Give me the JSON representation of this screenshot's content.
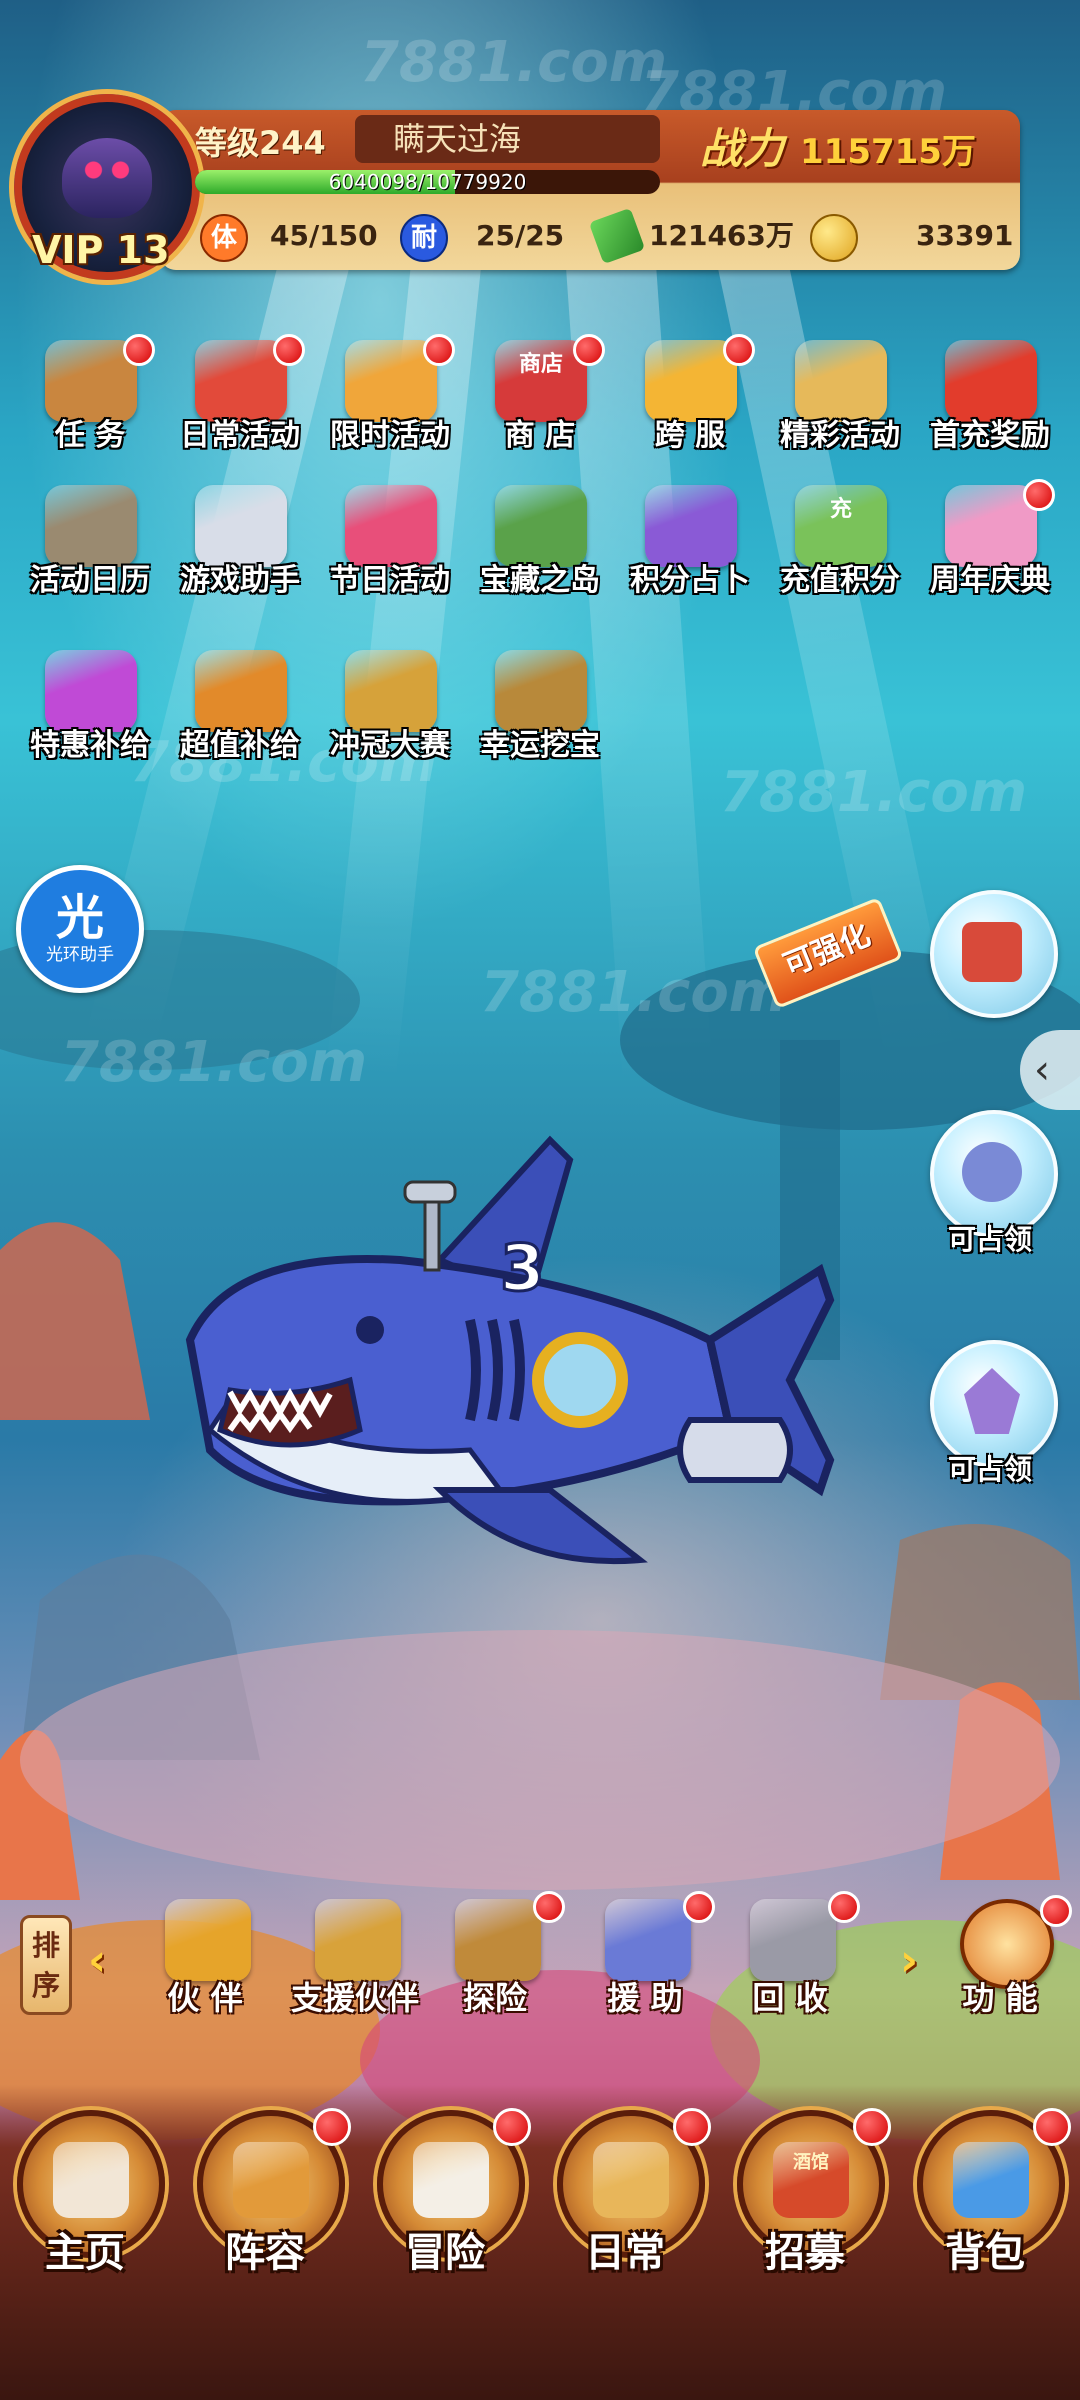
{
  "player": {
    "vip": "VIP 13",
    "level_label": "等级244",
    "name": "瞒天过海",
    "exp_text": "6040098/10779920",
    "exp_fraction": 0.56,
    "power_label": "战力",
    "power_value": "115715万"
  },
  "resources": [
    {
      "icon": "体",
      "value": "45/150"
    },
    {
      "icon": "耐",
      "value": "25/25"
    },
    {
      "icon": "cash-icon",
      "value": "121463万"
    },
    {
      "icon": "coin-icon",
      "value": "33391"
    }
  ],
  "activity_icons": [
    {
      "label": "任 务",
      "color": "#c9863f",
      "badge": true
    },
    {
      "label": "日常活动",
      "color": "#e24a3a",
      "badge": true
    },
    {
      "label": "限时活动",
      "color": "#f0a63a",
      "badge": true
    },
    {
      "label": "商 店",
      "color": "#d63a3a",
      "badge": true,
      "sign": "商店"
    },
    {
      "label": "跨 服",
      "color": "#f4b534",
      "badge": true
    },
    {
      "label": "精彩活动",
      "color": "#e6b95a",
      "badge": false
    },
    {
      "label": "首充奖励",
      "color": "#e23c2c",
      "badge": false
    },
    {
      "label": "活动日历",
      "color": "#9a8a70",
      "badge": false
    },
    {
      "label": "游戏助手",
      "color": "#d8dde8",
      "badge": false
    },
    {
      "label": "节日活动",
      "color": "#e84f7a",
      "badge": false
    },
    {
      "label": "宝藏之岛",
      "color": "#5aa24a",
      "badge": false
    },
    {
      "label": "积分占卜",
      "color": "#8a5ad6",
      "badge": false
    },
    {
      "label": "充值积分",
      "color": "#7ac25a",
      "badge": false,
      "sign": "充"
    },
    {
      "label": "周年庆典",
      "color": "#f09ac6",
      "badge": true
    },
    {
      "label": "特惠补给",
      "color": "#c04ad6",
      "badge": false
    },
    {
      "label": "超值补给",
      "color": "#e28a2a",
      "badge": false
    },
    {
      "label": "冲冠大赛",
      "color": "#d6a23a",
      "badge": false
    },
    {
      "label": "幸运挖宝",
      "color": "#b8893a",
      "badge": false
    }
  ],
  "helper": {
    "char": "光",
    "label": "光环助手"
  },
  "strengthen": "可强化",
  "side_buttons": [
    {
      "label": "",
      "color": "#d84a3a"
    },
    {
      "label": "可占领",
      "color": "#7a8ad6"
    },
    {
      "label": "可占领",
      "color": "#9a7ad6"
    }
  ],
  "collapse_icon": "‹",
  "func_bar": {
    "sort_label": "排序",
    "items": [
      {
        "label": "伙 伴",
        "color": "#e6a42a",
        "badge": false
      },
      {
        "label": "支援伙伴",
        "color": "#d8a23a",
        "badge": false
      },
      {
        "label": "探险",
        "color": "#c08a3a",
        "badge": true
      },
      {
        "label": "援 助",
        "color": "#6a7ad6",
        "badge": true
      },
      {
        "label": "回 收",
        "color": "#9a9aa6",
        "badge": true
      }
    ],
    "more_label": "功 能"
  },
  "bottom_nav": [
    {
      "label": "主页",
      "color": "#f2e6d6",
      "badge": false
    },
    {
      "label": "阵容",
      "color": "#e29a3a",
      "badge": true
    },
    {
      "label": "冒险",
      "color": "#f4efe6",
      "badge": true
    },
    {
      "label": "日常",
      "color": "#e8b65a",
      "badge": true
    },
    {
      "label": "招募",
      "color": "#d64a2a",
      "badge": true,
      "sign": "酒馆"
    },
    {
      "label": "背包",
      "color": "#4a9ae6",
      "badge": true
    }
  ],
  "shark": {
    "number": "3"
  },
  "watermark": "7881.com"
}
